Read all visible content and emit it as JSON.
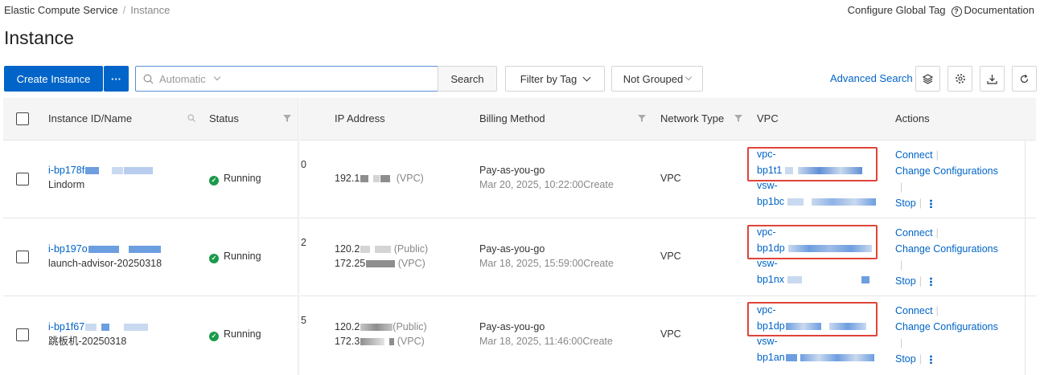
{
  "breadcrumb": {
    "root": "Elastic Compute Service",
    "current": "Instance"
  },
  "header": {
    "configure_tag": "Configure Global Tag",
    "documentation": "Documentation"
  },
  "page_title": "Instance",
  "toolbar": {
    "create_label": "Create Instance",
    "more_label": "···",
    "search_placeholder": "Automatic",
    "search_label": "Search",
    "filter_tag_label": "Filter by Tag",
    "group_label": "Not Grouped",
    "advanced_search": "Advanced Search"
  },
  "columns": {
    "instance": "Instance ID/Name",
    "status": "Status",
    "ip": "IP Address",
    "billing": "Billing Method",
    "network": "Network Type",
    "vpc": "VPC",
    "actions": "Actions"
  },
  "rows": [
    {
      "id_prefix": "i-bp178f",
      "name": "Lindorm",
      "status": "Running",
      "zone_digit": "0",
      "ip1_prefix": "192.1",
      "ip1_suffix": "(VPC)",
      "ip2_prefix": "",
      "ip2_suffix": "",
      "billing": "Pay-as-you-go",
      "created": "Mar 20, 2025, 10:22:00Create",
      "network": "VPC",
      "vpc_line1": "vpc-",
      "vpc_line2": "bp1t1",
      "vsw_line1": "vsw-",
      "vsw_line2": "bp1bc"
    },
    {
      "id_prefix": "i-bp197o",
      "name": "launch-advisor-20250318",
      "status": "Running",
      "zone_digit": "2",
      "ip1_prefix": "120.2",
      "ip1_suffix": "(Public)",
      "ip2_prefix": "172.25",
      "ip2_suffix": "(VPC)",
      "billing": "Pay-as-you-go",
      "created": "Mar 18, 2025, 15:59:00Create",
      "network": "VPC",
      "vpc_line1": "vpc-",
      "vpc_line2": "bp1dp",
      "vsw_line1": "vsw-",
      "vsw_line2": "bp1nx"
    },
    {
      "id_prefix": "i-bp1f67",
      "name": "跳板机-20250318",
      "status": "Running",
      "zone_digit": "5",
      "ip1_prefix": "120.2",
      "ip1_suffix": "(Public)",
      "ip2_prefix": "172.3",
      "ip2_suffix": "(VPC)",
      "billing": "Pay-as-you-go",
      "created": "Mar 18, 2025, 11:46:00Create",
      "network": "VPC",
      "vpc_line1": "vpc-",
      "vpc_line2": "bp1dp",
      "vsw_line1": "vsw-",
      "vsw_line2": "bp1an"
    }
  ],
  "actions": {
    "connect": "Connect",
    "change": "Change Configurations",
    "stop": "Stop"
  },
  "colors": {
    "primary": "#0064c8",
    "running": "#1a9a4a",
    "highlight": "#e0443a"
  }
}
